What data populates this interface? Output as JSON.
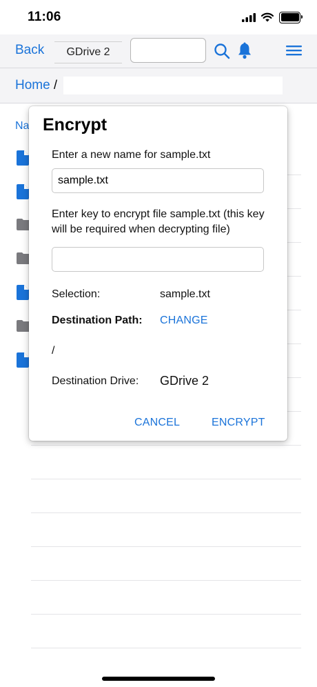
{
  "status_bar": {
    "time": "11:06"
  },
  "toolbar": {
    "back_label": "Back",
    "drive_label": "GDrive 2",
    "search_value": "",
    "accent_color": "#1a73d9"
  },
  "breadcrumb": {
    "home_label": "Home",
    "separator": "/"
  },
  "file_list": {
    "header_label": "Na"
  },
  "dialog": {
    "title": "Encrypt",
    "rename_prompt": "Enter a new name for sample.txt",
    "name_value": "sample.txt",
    "key_prompt": "Enter key to encrypt file sample.txt (this key will be required when decrypting file)",
    "key_value": "",
    "selection_label": "Selection:",
    "selection_value": "sample.txt",
    "destination_path_label": "Destination Path:",
    "change_label": "CHANGE",
    "path_value": "/",
    "destination_drive_label": "Destination Drive:",
    "destination_drive_value": "GDrive 2",
    "cancel_label": "CANCEL",
    "encrypt_label": "ENCRYPT"
  }
}
